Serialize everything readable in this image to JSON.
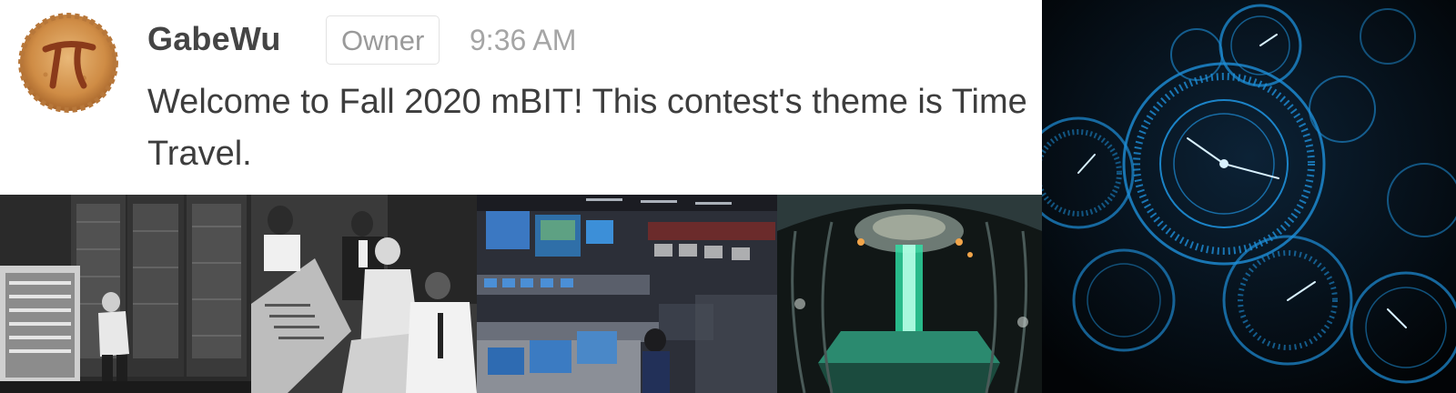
{
  "message": {
    "username": "GabeWu",
    "role": "Owner",
    "time": "9:36 AM",
    "text": "Welcome to Fall 2020 mBIT! This contest's theme is Time Travel.",
    "avatar_icon": "pi-pie-icon"
  },
  "colors": {
    "username": "#444444",
    "badge_text": "#9a9a9a",
    "timestamp": "#a5a5a5",
    "message_text": "#3d3d3d",
    "clock_glow": "#1e8fd8",
    "tardis_glow": "#2fe3a8"
  },
  "images": [
    {
      "name": "vintage-computer-photo"
    },
    {
      "name": "computer-operators-photo"
    },
    {
      "name": "mission-control-photo"
    },
    {
      "name": "time-machine-console-photo"
    },
    {
      "name": "fractal-clocks-image"
    }
  ]
}
